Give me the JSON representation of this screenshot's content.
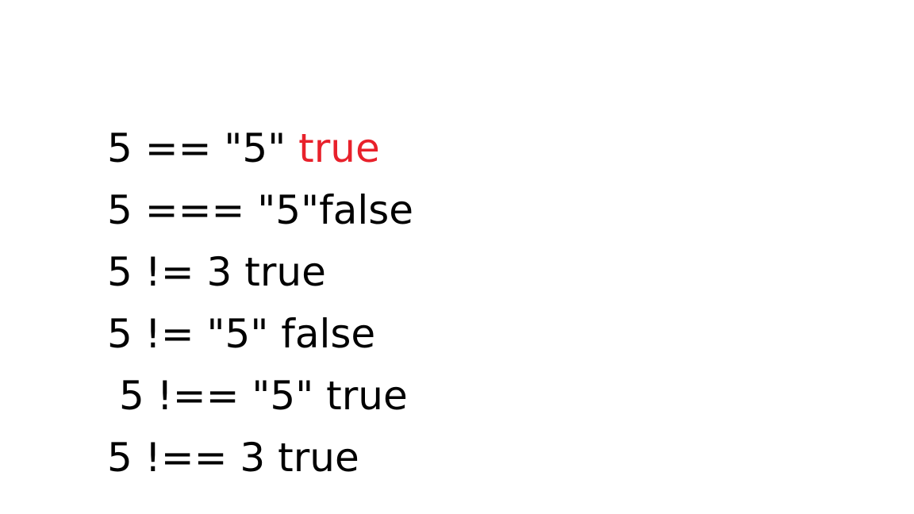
{
  "colors": {
    "background": "#ffffff",
    "text": "#000000",
    "highlight": "#e8212b"
  },
  "lines": [
    {
      "expr": "5 == \"5\" ",
      "result": "true"
    },
    {
      "expr": "5 === \"5\"",
      "result": "false"
    },
    {
      "expr": "5 != 3 ",
      "result": "true"
    },
    {
      "expr": "5 != \"5\" ",
      "result": "false"
    },
    {
      "expr": "5 !== \"5\" ",
      "result": "true"
    },
    {
      "expr": "5 !== 3 ",
      "result": "true"
    }
  ]
}
